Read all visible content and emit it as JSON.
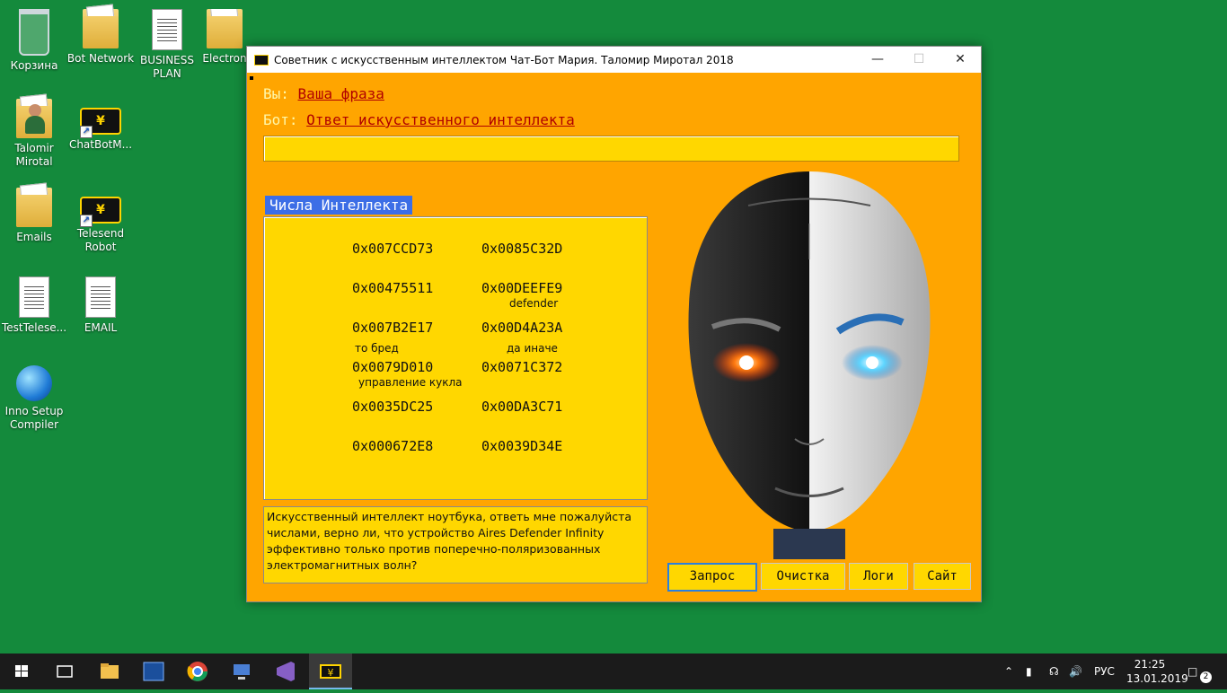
{
  "desktop": {
    "icons": [
      {
        "label": "Корзина",
        "icon": "recycle-bin-icon"
      },
      {
        "label": "Bot Network",
        "icon": "folder-icon"
      },
      {
        "label": "BUSINESS PLAN",
        "icon": "document-icon"
      },
      {
        "label": "Electron",
        "icon": "folder-icon"
      },
      {
        "label": "Talomir Mirotal",
        "icon": "user-folder-icon"
      },
      {
        "label": "ChatBotM...",
        "icon": "chatbot-shortcut-icon"
      },
      {
        "label": "Emails",
        "icon": "folder-icon"
      },
      {
        "label": "Telesend Robot",
        "icon": "chatbot-shortcut-icon"
      },
      {
        "label": "TestTelese...",
        "icon": "text-file-icon"
      },
      {
        "label": "EMAIL",
        "icon": "document-icon"
      },
      {
        "label": "Inno Setup Compiler",
        "icon": "inno-setup-icon"
      }
    ]
  },
  "window": {
    "title": "Советник с искусственным интеллектом Чат-Бот Мария. Таломир Миротал 2018",
    "user_key": "Вы:",
    "user_value": "Ваша фраза",
    "bot_key": "Бот:",
    "bot_value": "Ответ искусственного интеллекта",
    "input_value": "",
    "section_title": "Числа Интеллекта",
    "hex_left": [
      "0x007CCD73",
      "0x00475511",
      "0x007B2E17",
      "0x0079D010",
      "0x0035DC25",
      "0x000672E8"
    ],
    "hex_right": [
      "0x0085C32D",
      "0x00DEEFE9",
      "0x00D4A23A",
      "0x0071C372",
      "0x00DA3C71",
      "0x0039D34E"
    ],
    "notes": {
      "defender": "defender",
      "nonsense": "то бред",
      "otherwise": "да иначе",
      "control": "управление кукла"
    },
    "question": "Искусственный интеллект ноутбука, ответь мне пожалуйста числами, верно ли, что устройство Aires Defender Infinity эффективно только против поперечно-поляризованных электромагнитных волн?",
    "buttons": {
      "request": "Запрос",
      "clear": "Очистка",
      "logs": "Логи",
      "site": "Сайт"
    }
  },
  "taskbar": {
    "language": "РУС",
    "time": "21:25",
    "date": "13.01.2019",
    "notification_count": "2"
  },
  "colors": {
    "desktop": "#148a3c",
    "window_bg": "#ffa500",
    "panel_bg": "#ffd700",
    "accent_blue": "#3c6ee6"
  }
}
